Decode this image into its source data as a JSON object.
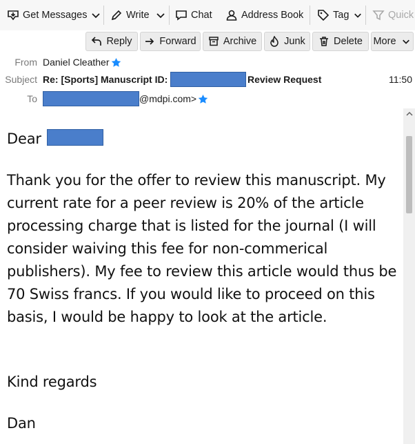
{
  "toolbar": {
    "get_messages": "Get Messages",
    "write": "Write",
    "chat": "Chat",
    "address_book": "Address Book",
    "tag": "Tag",
    "quick_filter": "Quick"
  },
  "header_actions": {
    "reply": "Reply",
    "forward": "Forward",
    "archive": "Archive",
    "junk": "Junk",
    "delete": "Delete",
    "more": "More"
  },
  "message": {
    "from_label": "From",
    "from_value": "Daniel Cleather",
    "subject_label": "Subject",
    "subject_prefix": "Re: [Sports] Manuscript ID:",
    "subject_suffix": "Review Request",
    "time": "11:50",
    "to_label": "To",
    "to_suffix": "@mdpi.com>"
  },
  "body": {
    "greeting": "Dear",
    "paragraph": "Thank you for the offer to review this manuscript. My current rate for a peer review is 20% of the article processing charge that is listed for the journal (I will consider waiving this fee for non-commerical publishers).  My fee to review this article would thus be 70 Swiss francs.  If you would like to proceed on this basis, I would be happy to look at the article.",
    "closing": "Kind regards",
    "signature": "Dan"
  },
  "colors": {
    "redaction": "#4a7ecb",
    "star": "#1a8cff"
  }
}
